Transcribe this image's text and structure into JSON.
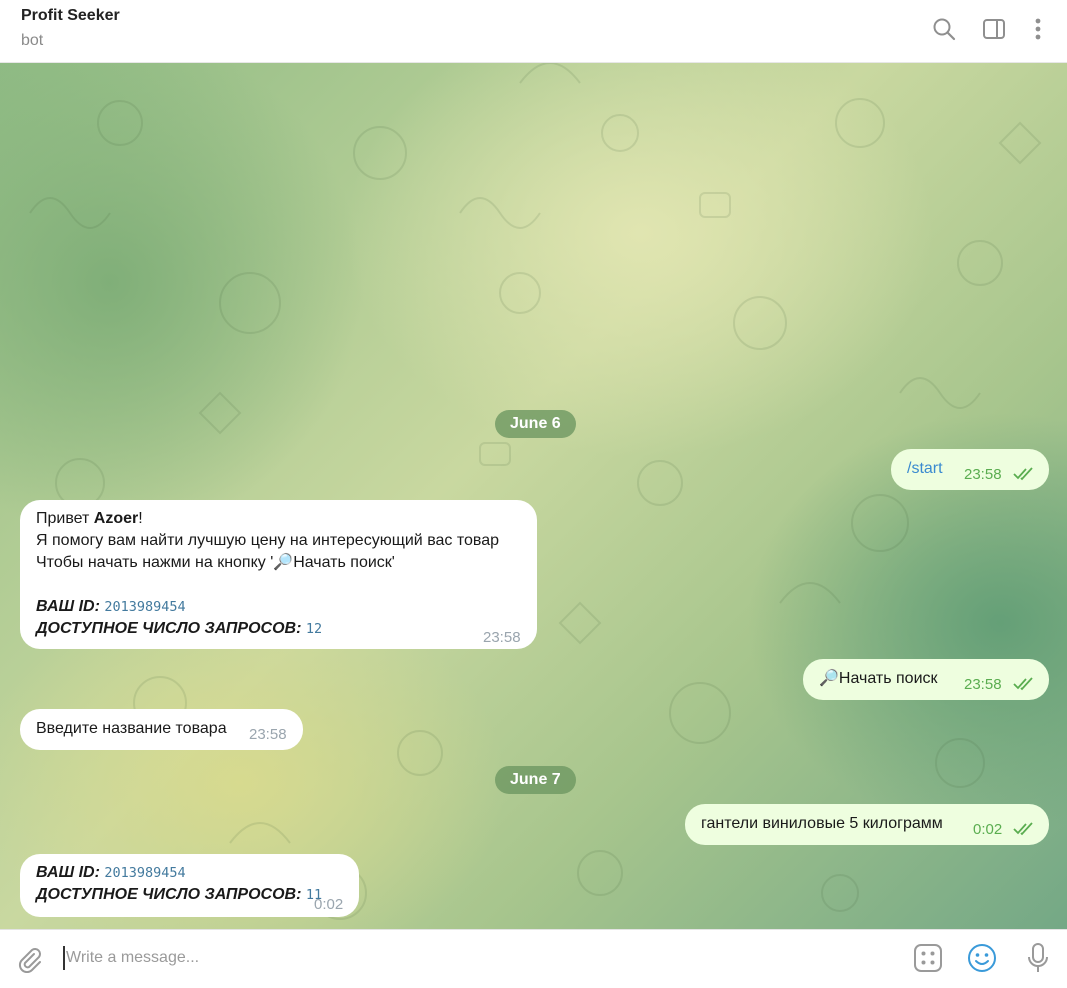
{
  "header": {
    "title": "Profit Seeker",
    "subtitle": "bot"
  },
  "dates": [
    "June 6",
    "June 7"
  ],
  "messages": {
    "m1": {
      "text": "/start",
      "time": "23:58"
    },
    "m2": {
      "greet": "Привет ",
      "name": "Azoer",
      "excl": "!",
      "line2": "Я помогу вам найти лучшую цену на интересующий вас товар",
      "line3": "Чтобы начать нажми на кнопку '🔎Начать поиск'",
      "id_label": "ВАШ ID:",
      "id_value": "2013989454",
      "req_label": "ДОСТУПНОЕ ЧИСЛО ЗАПРОСОВ:",
      "req_value": "12",
      "time": "23:58"
    },
    "m3": {
      "text": "🔎Начать поиск",
      "time": "23:58"
    },
    "m4": {
      "text": "Введите название товара",
      "time": "23:58"
    },
    "m5": {
      "text": "гантели виниловые 5 килограмм",
      "time": "0:02"
    },
    "m6": {
      "id_label": "ВАШ ID:",
      "id_value": "2013989454",
      "req_label": "ДОСТУПНОЕ ЧИСЛО ЗАПРОСОВ:",
      "req_value": "11",
      "time": "0:02"
    }
  },
  "composer": {
    "placeholder": "Write a message..."
  },
  "icons": {
    "header": [
      "search-icon",
      "sidebar-toggle-icon",
      "more-vertical-icon"
    ],
    "composer": [
      "attach-icon",
      "bot-commands-icon",
      "emoji-icon",
      "microphone-icon"
    ],
    "status": "double-check-icon"
  },
  "colors": {
    "outgoing_bubble": "#eefedf",
    "incoming_bubble": "#ffffff",
    "accent": "#3a8ad0",
    "time_read": "#5aad50",
    "date_pill": "#6c9660"
  }
}
